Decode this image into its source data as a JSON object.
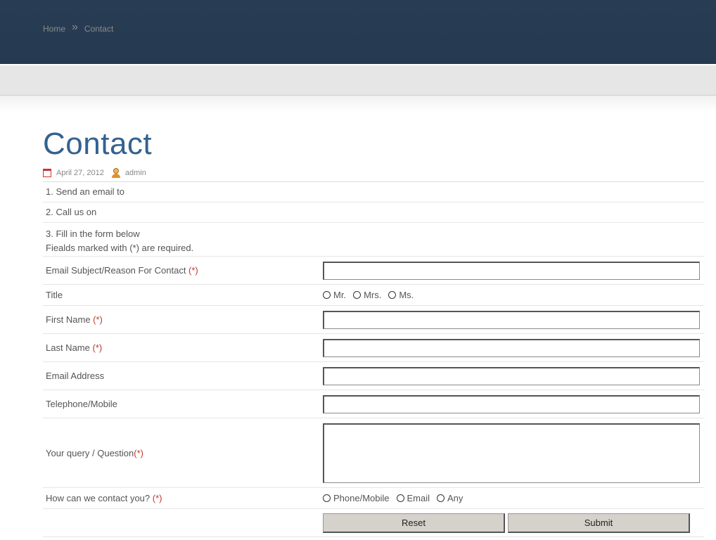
{
  "breadcrumb": {
    "home": "Home",
    "separator": "»",
    "current": "Contact"
  },
  "page": {
    "title": "Contact",
    "date": "April 27, 2012",
    "author": "admin"
  },
  "intro": {
    "line1": "1. Send an email to",
    "line2": "2. Call us on",
    "line3": "3. Fill in the form below",
    "line4": "Fiealds marked with (*) are required."
  },
  "form": {
    "required_marker": "(*)",
    "subject_label": "Email Subject/Reason For Contact ",
    "title_label": "Title",
    "title_options": [
      "Mr.",
      "Mrs.",
      "Ms."
    ],
    "first_name_label": "First Name ",
    "last_name_label": "Last Name ",
    "email_label": "Email Address",
    "phone_label": "Telephone/Mobile",
    "query_label": "Your query / Question",
    "contact_label": "How can we contact you? ",
    "contact_options": [
      "Phone/Mobile",
      "Email",
      "Any"
    ],
    "reset_label": "Reset",
    "submit_label": "Submit"
  }
}
